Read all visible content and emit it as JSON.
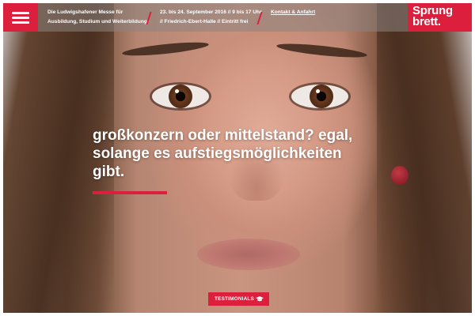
{
  "header": {
    "tagline_line1": "Die Ludwigshafener Messe für",
    "tagline_line2": "Ausbildung, Studium und Weiterbildung",
    "event_date": "23. bis 24. September 2016 // 9 bis 17 Uhr",
    "event_location": "// Friedrich-Ebert-Halle // Eintritt frei",
    "contact_link": "Kontakt & Anfahrt",
    "logo_line1": "Sprung",
    "logo_line2": "brett."
  },
  "hero": {
    "headline": "großkonzern oder mittelstand? egal, solange es aufstiegsmöglichkeiten gibt."
  },
  "cta": {
    "label": "TESTIMONIALS",
    "icon": "graduation-cap-icon"
  },
  "colors": {
    "accent": "#dc1f3c"
  }
}
